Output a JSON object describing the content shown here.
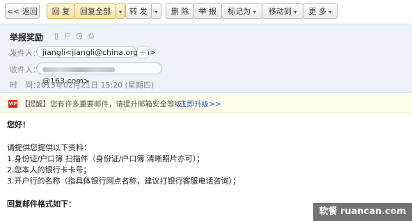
{
  "toolbar": {
    "back": "<< 返回",
    "reply": "回 复",
    "reply_all": "回复全部",
    "forward": "转 发",
    "delete": "删 除",
    "report": "举 报",
    "mark_as": "标记为",
    "move_to": "移动到",
    "more": "更 多"
  },
  "icons": {
    "caret": "▾",
    "flag": "⚐",
    "clock": "◷",
    "print": "⎙",
    "tag": "▯",
    "plus": "+"
  },
  "mail": {
    "subject": "举报奖励",
    "from_label": "发件人：",
    "from_value": "jiangli<jiangli@china.org.cn>",
    "to_label": "收件人：",
    "to_domain": "@163.com>",
    "time_label": "时　间：",
    "time_value": "2013年02月21日 15:20 (星期四)"
  },
  "warning": {
    "badge": "VIP",
    "text": "【提醒】您有许多重要邮件，请提升邮箱安全等级！",
    "link": "立即升级>>"
  },
  "body_lines": {
    "l1": "您好！",
    "l2": "请提供您提供以下资料：",
    "l3": "1.身份证/户口簿 扫描件（身份证/户口簿 清晰照片亦可）；",
    "l4": "2.您本人的银行卡卡号；",
    "l5": "3.开户行的名称（指具体银行网点名称，建议打银行客服电话咨询）；",
    "l6": "回复邮件格式如下："
  },
  "watermark": "软餐 ruancan.com",
  "colors": {
    "header_bg": "#eef2f8",
    "warning_bg": "#fdfbe9",
    "link": "#1b64c8",
    "vip_badge": "#d8271c"
  }
}
